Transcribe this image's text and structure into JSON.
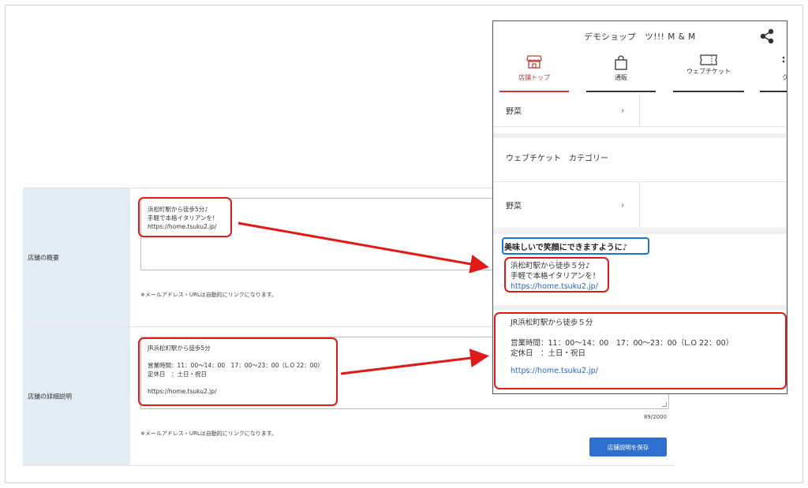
{
  "admin_form": {
    "overview_label": "店舗の概要",
    "overview_text": "浜松町駅から徒歩5分♪\n手軽で本格イタリアンを！\nhttps://home.tsuku2.jp/",
    "overview_note": "※メールアドレス・URLは自動的にリンクになります。",
    "detail_label": "店舗の詳細説明",
    "detail_text": "JR浜松町駅から徒歩5分\n\n営業時間：11：00〜14：00　17：00〜23：00（L.O 22：00）\n定休日　：土日・祝日\n\nhttps://home.tsuku2.jp/",
    "detail_counter": "89/2000",
    "detail_note": "※メールアドレス・URLは自動的にリンクになります。",
    "save_button": "店舗説明を保存"
  },
  "phone_preview": {
    "shop_title": "デモショップ　ツ!!! M & M",
    "nav_tabs": [
      {
        "label": "店舗トップ",
        "icon": "storefront-icon",
        "active": true
      },
      {
        "label": "通販",
        "icon": "shopping-bag-icon",
        "active": false
      },
      {
        "label": "ウェブチケット",
        "icon": "ticket-icon",
        "active": false
      },
      {
        "label": "ク",
        "icon": "more-icon",
        "active": false
      }
    ],
    "category_item_1": "野菜",
    "ticket_category_heading": "ウェブチケット　カテゴリー",
    "category_item_2": "野菜",
    "overview_heading": "美味しいで笑顔にできますように♪",
    "overview_line1": "浜松町駅から徒歩５分♪",
    "overview_line2": "手軽で本格イタリアンを！",
    "overview_link": "https://home.tsuku2.jp/",
    "detail_text": "JR浜松町駅から徒歩５分\n\n営業時間：11：00〜14：00　17：00〜23：00（L.O 22：00）\n定休日　：土日・祝日",
    "detail_link": "https://home.tsuku2.jp/"
  },
  "colors": {
    "accent_red": "#c23a3a",
    "annotation_red": "#e01919",
    "annotation_blue": "#1f73c7",
    "button_blue": "#2f6fcf",
    "link_blue": "#2a63c7",
    "label_bg": "#e4ecf5"
  }
}
